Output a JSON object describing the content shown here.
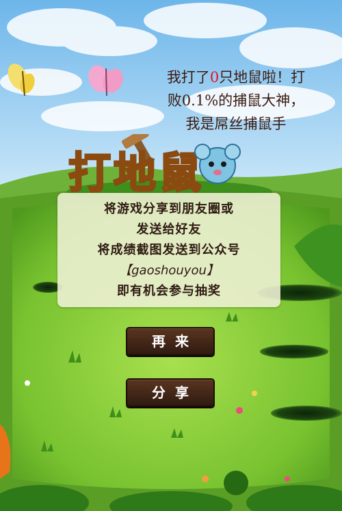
{
  "result": {
    "line1_prefix": "我打了",
    "count": "0",
    "line1_suffix": "只地鼠啦！打",
    "line2": "败0.1%的捕鼠大神，",
    "line3": "我是屌丝捕鼠手"
  },
  "logo": {
    "text": "打地鼠"
  },
  "panel": {
    "line1": "将游戏分享到朋友圈或",
    "line2": "发送给好友",
    "line3": "将成绩截图发送到公众号",
    "account": "【gaoshouyou】",
    "line5": "即有机会参与抽奖"
  },
  "buttons": {
    "again": "再来",
    "share": "分享"
  },
  "colors": {
    "sky": "#8cc8ef",
    "grass": "#7cc23c",
    "button": "#3d2315",
    "count": "#e8102a"
  }
}
